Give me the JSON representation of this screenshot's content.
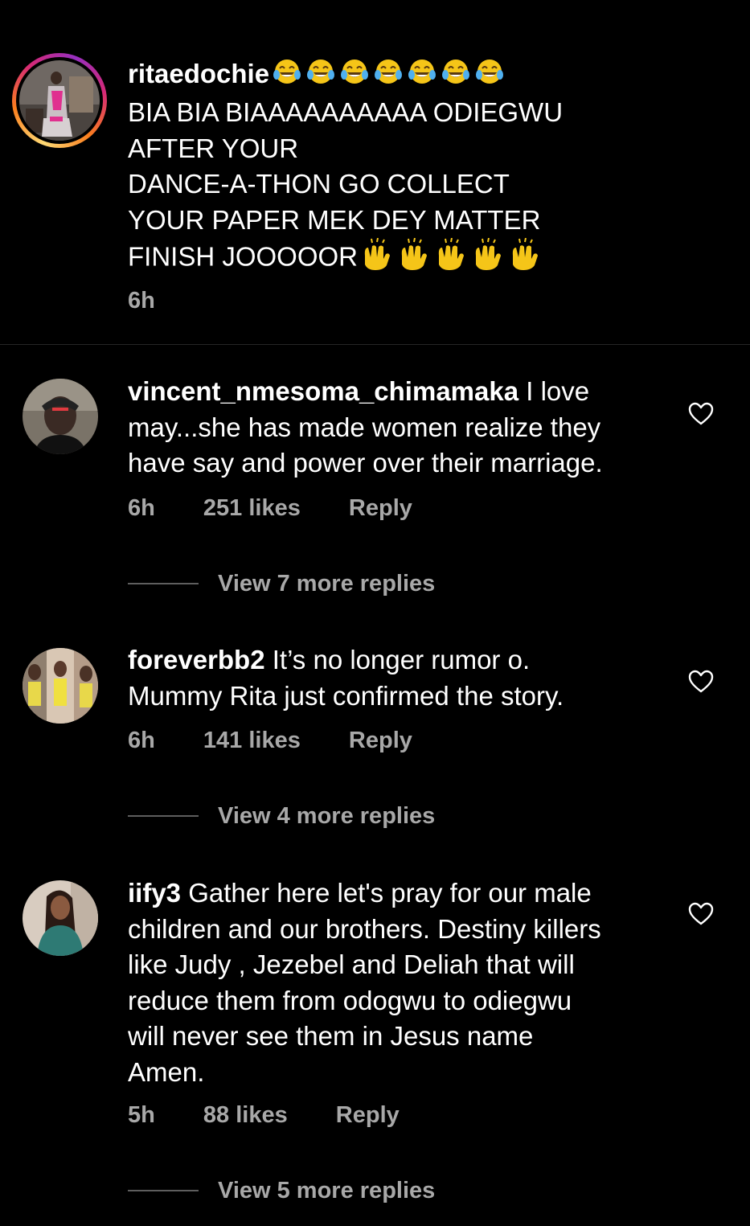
{
  "caption": {
    "username": "ritaedochie",
    "lines": [
      "BIA BIA BIAAAAAAAAAA ODIEGWU",
      "AFTER YOUR",
      "DANCE-A-THON GO COLLECT",
      "YOUR PAPER MEK DEY MATTER",
      "FINISH JOOOOOR"
    ],
    "laugh_emoji_count": 7,
    "raised_hands_emoji_count": 5,
    "time": "6h"
  },
  "comments": [
    {
      "username": "vincent_nmesoma_chimamaka",
      "lines": [
        "I love",
        "may...she has made women realize they",
        "have say and power over their marriage."
      ],
      "time": "6h",
      "likes": "251 likes",
      "reply_label": "Reply",
      "view_replies": "View 7 more replies"
    },
    {
      "username": "foreverbb2",
      "lines": [
        "It’s no longer rumor o.",
        "Mummy Rita just confirmed the story."
      ],
      "time": "6h",
      "likes": "141 likes",
      "reply_label": "Reply",
      "view_replies": "View 4 more replies"
    },
    {
      "username": "iify3",
      "lines": [
        "Gather here let's pray for our male",
        "children and our brothers. Destiny killers",
        "like Judy , Jezebel and Deliah that will",
        "reduce them from odogwu to odiegwu",
        "will never see them in Jesus name",
        "Amen."
      ],
      "time": "5h",
      "likes": "88 likes",
      "reply_label": "Reply",
      "view_replies": "View 5 more replies"
    }
  ],
  "icons": {
    "heart": "heart-outline-icon",
    "laugh": "face-with-tears-of-joy-emoji",
    "hands": "raised-hands-emoji"
  },
  "colors": {
    "background": "#000000",
    "text": "#ffffff",
    "meta": "#a8a8a8",
    "divider": "#262626",
    "emoji_yellow": "#f5c518"
  }
}
